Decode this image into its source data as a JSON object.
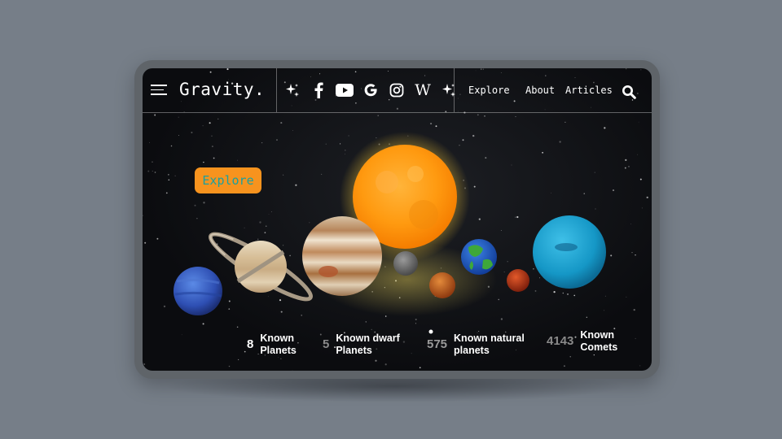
{
  "brand": {
    "name": "Gravity."
  },
  "social": {
    "items": [
      {
        "name": "sparkle-icon",
        "glyph": "✦"
      },
      {
        "name": "facebook-icon",
        "glyph": "f"
      },
      {
        "name": "youtube-icon",
        "glyph": "▶"
      },
      {
        "name": "google-icon",
        "glyph": "G"
      },
      {
        "name": "instagram-icon",
        "glyph": "◎"
      },
      {
        "name": "wikipedia-icon",
        "glyph": "W"
      },
      {
        "name": "sparkle-icon",
        "glyph": "✦"
      }
    ]
  },
  "nav": {
    "explore": "Explore",
    "about": "About",
    "articles": "Articles"
  },
  "hero": {
    "cta_label": "Explore"
  },
  "stats": [
    {
      "number": "8",
      "label_line1": "Known",
      "label_line2": "Planets",
      "number_color": "#ffffff"
    },
    {
      "number": "5",
      "label_line1": "Known dwarf",
      "label_line2": "Planets",
      "number_color": "#8a8a8a"
    },
    {
      "number": "575",
      "label_line1": "Known natural",
      "label_line2": "planets",
      "number_color": "#9a9a9a"
    },
    {
      "number": "4143",
      "label_line1": "Known",
      "label_line2": "Comets",
      "number_color": "#8a8a8a"
    }
  ],
  "colors": {
    "accent": "#f7931e",
    "cta_text": "#1aa0a0",
    "sun": "#ff9a10"
  }
}
